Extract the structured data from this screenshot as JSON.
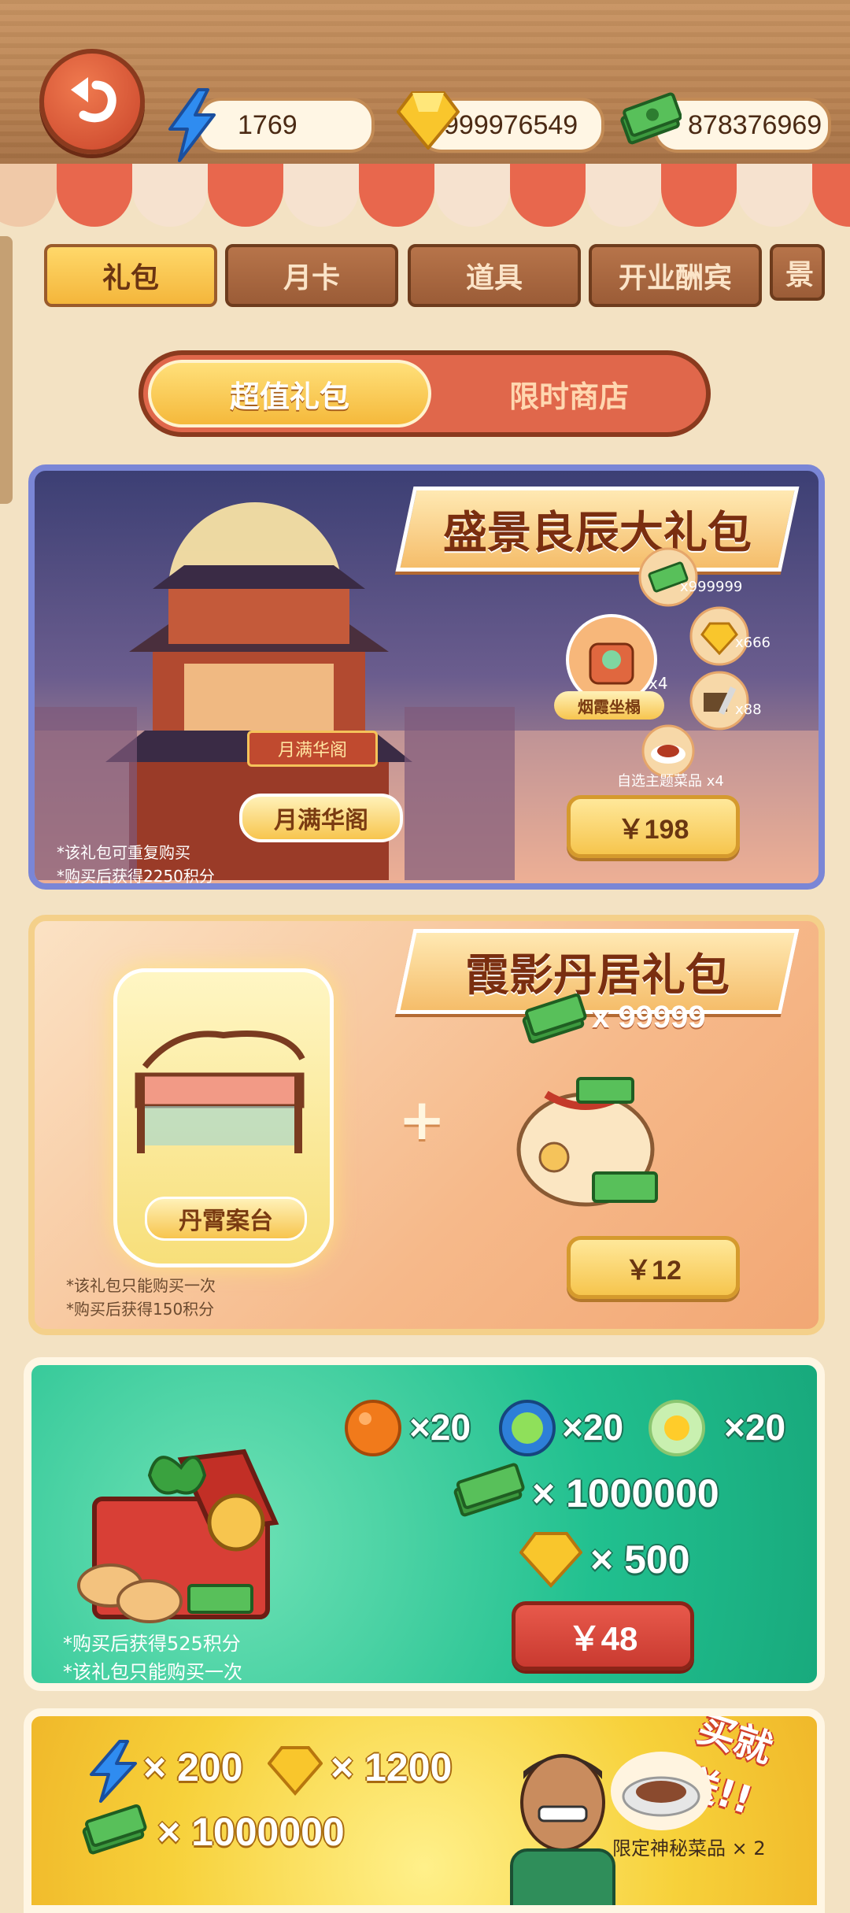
{
  "resources": {
    "energy": "1769",
    "gems": "999976549",
    "cash": "878376969"
  },
  "tabs": [
    "礼包",
    "月卡",
    "道具",
    "开业酬宾",
    "景"
  ],
  "segment": {
    "active": "超值礼包",
    "inactive": "限时商店"
  },
  "pack1": {
    "title": "盛景良辰大礼包",
    "building_sign": "月满华阁",
    "building_label": "月满华阁",
    "items": {
      "cash_qty": "x999999",
      "gem_qty": "x666",
      "robot_qty": "x4",
      "robot_label": "烟霞坐榻",
      "tool_qty": "x88",
      "dish_label": "自选主题菜品 x4"
    },
    "price": "￥198",
    "notes": [
      "*该礼包可重复购买",
      "*购买后获得2250积分"
    ]
  },
  "pack2": {
    "title": "霞影丹居礼包",
    "item_label": "丹霄案台",
    "cash_qty": "x 99999",
    "price": "￥12",
    "notes": [
      "*该礼包只能购买一次",
      "*购买后获得150积分"
    ]
  },
  "pack3": {
    "orange_qty": "×20",
    "green_qty": "×20",
    "egg_qty": "×20",
    "cash_qty": "× 1000000",
    "gem_qty": "× 500",
    "price": "￥48",
    "notes": [
      "*购买后获得525积分",
      "*该礼包只能购买一次"
    ]
  },
  "pack4": {
    "energy_qty": "× 200",
    "gem_qty": "× 1200",
    "cash_qty": "× 1000000",
    "promo": "买就送!!",
    "dish_label": "限定神秘菜品 × 2"
  }
}
